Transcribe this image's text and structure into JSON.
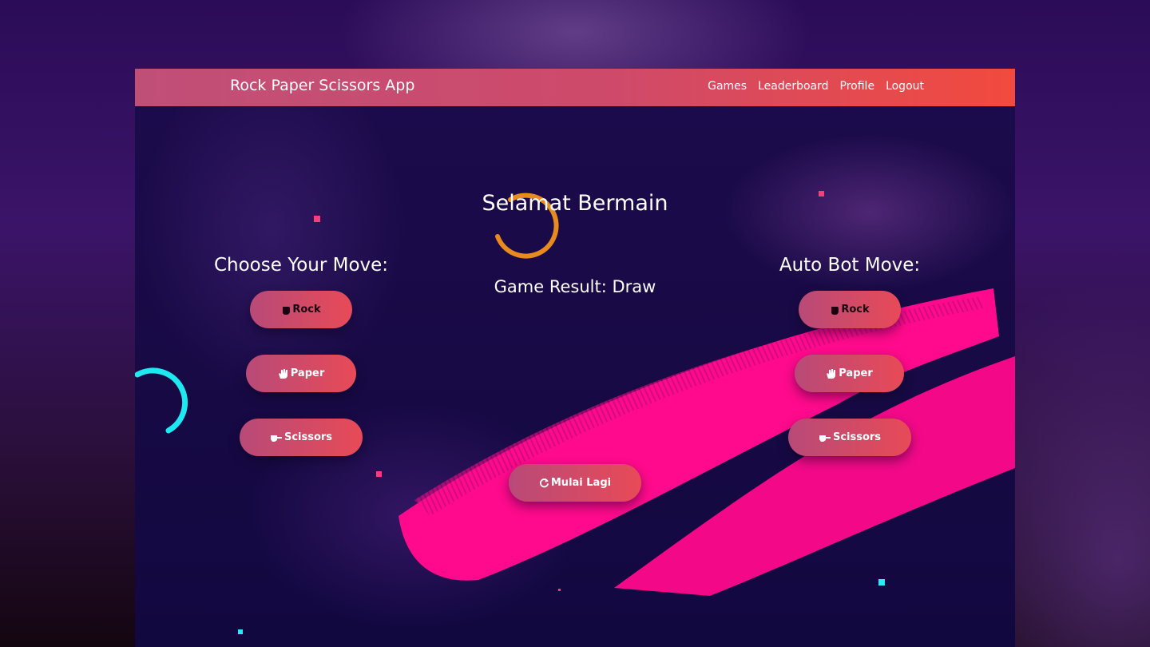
{
  "navbar": {
    "brand": "Rock Paper Scissors App",
    "links": [
      "Games",
      "Leaderboard",
      "Profile",
      "Logout"
    ]
  },
  "main": {
    "title": "Selamat Bermain",
    "result": "Game Result: Draw",
    "restart_label": "Mulai Lagi",
    "restart_icon": "refresh-icon"
  },
  "player": {
    "heading": "Choose Your Move:",
    "moves": [
      {
        "label": "Rock",
        "icon": "fist-icon"
      },
      {
        "label": "Paper",
        "icon": "hand-icon"
      },
      {
        "label": "Scissors",
        "icon": "scissors-hand-icon"
      }
    ]
  },
  "bot": {
    "heading": "Auto Bot Move:",
    "moves": [
      {
        "label": "Rock",
        "icon": "fist-icon"
      },
      {
        "label": "Paper",
        "icon": "hand-icon"
      },
      {
        "label": "Scissors",
        "icon": "scissors-hand-icon"
      }
    ]
  },
  "colors": {
    "nav_gradient_start": "#c04f78",
    "nav_gradient_end": "#f24a3e",
    "button_gradient_start": "#b84a78",
    "button_gradient_end": "#e84a57",
    "brush_pink": "#ff0a8c",
    "spinner_orange": "#e88a1e",
    "ring_cyan": "#1ee8f0"
  }
}
